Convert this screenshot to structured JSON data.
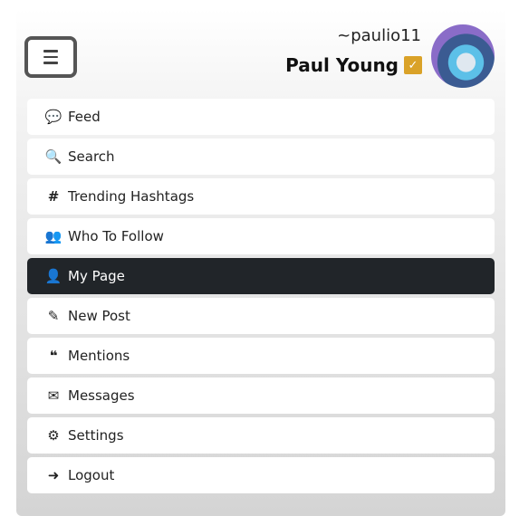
{
  "header": {
    "handle": "~paulio11",
    "display_name": "Paul Young",
    "verified_icon": "check-badge-icon",
    "badge_color": "#daa228"
  },
  "menu": {
    "items": [
      {
        "label": "Feed",
        "icon": "comments-icon",
        "glyph": "💬"
      },
      {
        "label": "Search",
        "icon": "search-icon",
        "glyph": "🔍"
      },
      {
        "label": "Trending Hashtags",
        "icon": "hashtag-icon",
        "glyph": "#"
      },
      {
        "label": "Who To Follow",
        "icon": "users-icon",
        "glyph": "👥"
      },
      {
        "label": "My Page",
        "icon": "user-icon",
        "glyph": "👤",
        "active": true
      },
      {
        "label": "New Post",
        "icon": "edit-icon",
        "glyph": "✎"
      },
      {
        "label": "Mentions",
        "icon": "quote-icon",
        "glyph": "❝"
      },
      {
        "label": "Messages",
        "icon": "envelope-icon",
        "glyph": "✉"
      },
      {
        "label": "Settings",
        "icon": "gear-icon",
        "glyph": "⚙"
      },
      {
        "label": "Logout",
        "icon": "logout-icon",
        "glyph": "➜"
      }
    ]
  }
}
